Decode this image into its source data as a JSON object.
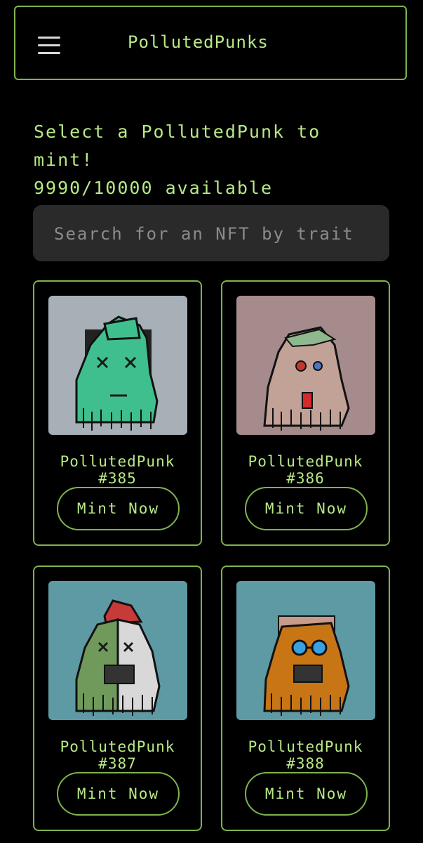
{
  "header": {
    "menu_icon": "hamburger-menu-icon",
    "title": "PollutedPunks"
  },
  "intro": {
    "line1": "Select a PollutedPunk to",
    "line2": "mint!",
    "availability": "9990/10000 available"
  },
  "search": {
    "placeholder": "Search for an NFT by trait"
  },
  "colors": {
    "accent": "#b8e986",
    "border": "#7fb34d",
    "background": "#000000",
    "search_bg": "#2a2a2a"
  },
  "nfts": [
    {
      "name_line1": "PollutedPunk",
      "name_line2": "#385",
      "button": "Mint Now",
      "art_bg": "#a7b0b7",
      "body_color": "#3fbf8e"
    },
    {
      "name_line1": "PollutedPunk",
      "name_line2": "#386",
      "button": "Mint Now",
      "art_bg": "#a58b8b",
      "body_color": "#c2a196"
    },
    {
      "name_line1": "PollutedPunk",
      "name_line2": "#387",
      "button": "Mint Now",
      "art_bg": "#5e9aa3",
      "body_color": "#6f9a5b"
    },
    {
      "name_line1": "PollutedPunk",
      "name_line2": "#388",
      "button": "Mint Now",
      "art_bg": "#5e9aa3",
      "body_color": "#c87515"
    }
  ]
}
